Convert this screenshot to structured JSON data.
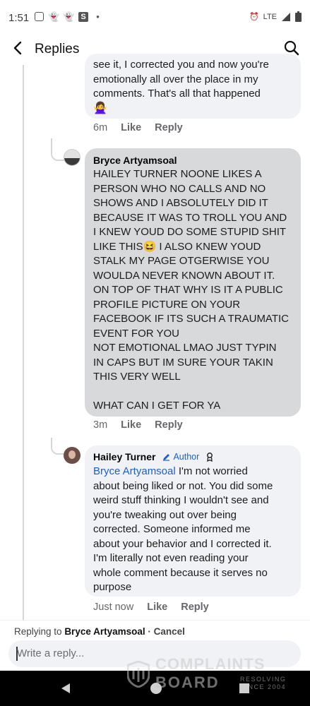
{
  "status_bar": {
    "time": "1:51",
    "network": "LTE",
    "icons": [
      "instagram-icon",
      "snapchat-icon",
      "snapchat-icon",
      "s-app-icon",
      "dot-icon",
      "alarm-icon",
      "signal-icon",
      "battery-icon"
    ]
  },
  "header": {
    "title": "Replies"
  },
  "comments": [
    {
      "text_top": "see it, I corrected you and now you're",
      "text": "emotionally all over the place in my\ncomments. That's all that happened",
      "emoji": "🙅‍♀️",
      "time": "6m",
      "like": "Like",
      "reply": "Reply"
    },
    {
      "author": "Bryce Artyamsoal",
      "text": "HAILEY TURNER NOONE LIKES A\nPERSON WHO NO CALLS AND NO\nSHOWS AND I ABSOLUTELY DID IT\nBECAUSE IT WAS TO TROLL YOU AND\nI KNEW YOUD DO SOME STUPID SHIT\nLIKE THIS😆 I ALSO KNEW YOUD\nSTALK MY PAGE OTGERWISE YOU\nWOULDA NEVER KNOWN ABOUT IT.\nON TOP OF THAT WHY IS IT A PUBLIC\nPROFILE PICTURE ON YOUR\nFACEBOOK IF ITS SUCH A TRAUMATIC\nEVENT FOR YOU\nNOT EMOTIONAL LMAO JUST TYPIN\nIN CAPS BUT IM SURE YOUR TAKIN\nTHIS VERY WELL\n\nWHAT CAN I GET FOR YA",
      "time": "3m",
      "like": "Like",
      "reply": "Reply"
    },
    {
      "author": "Hailey Turner",
      "badge": "Author",
      "mention": "Bryce Artyamsoal",
      "text": " I'm not worried\nabout being liked or not. You did some\nweird stuff thinking I wouldn't see and\nyou're tweaking out over being\ncorrected. Someone informed me\nabout your behavior and I corrected it.\nI'm literally not even reading your\nwhole comment because it serves no\npurpose",
      "time": "Just now",
      "like": "Like",
      "reply": "Reply"
    }
  ],
  "reply_bar": {
    "prefix": "Replying to",
    "name": "Bryce Artyamsoal",
    "cancel": "· Cancel",
    "placeholder": "Write a reply..."
  },
  "watermark": {
    "line1": "COMPLAINTS",
    "line2": "BOARD",
    "line3": "RESOLVING",
    "line4": "SINCE 2004"
  }
}
